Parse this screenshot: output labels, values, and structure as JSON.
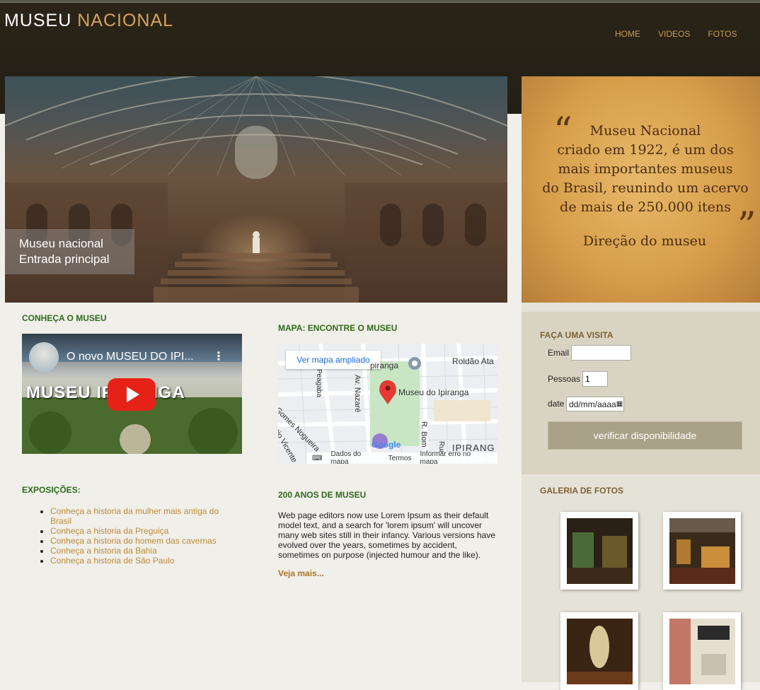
{
  "header": {
    "logo_part1": "MUSEU ",
    "logo_part2": "NACIONAL",
    "nav": [
      "HOME",
      "VIDEOS",
      "FOTOS"
    ]
  },
  "hero": {
    "caption_line1": "Museu nacional",
    "caption_line2": "Entrada principal"
  },
  "quote": {
    "open_mark": "“",
    "close_mark": "”",
    "lines": [
      "Museu Nacional",
      "criado em 1922, é um dos",
      "mais importantes museus",
      "do Brasil, reunindo um acervo",
      "de mais de 250.000 itens"
    ],
    "signature": "Direção do museu"
  },
  "conheca": {
    "title": "CONHEÇA O MUSEU",
    "video_title": "O novo MUSEU DO IPI...",
    "video_overlay": "MUSEU         IPIRANGA"
  },
  "mapa": {
    "title": "MAPA: ENCONTRE O MUSEU",
    "open_button": "Ver mapa ampliado",
    "place_label": "Museu do Ipiranga",
    "streets": [
      "Roldão Ata",
      "Av. Nazaré",
      "Gomes Nogueira",
      "R. Bom",
      "cio Vicente",
      "IPIRANG",
      "Rua",
      "Peagaba",
      "piranga"
    ],
    "google_label": "Google",
    "footer": [
      "Dados do mapa",
      "Termos",
      "Informar erro no mapa"
    ]
  },
  "exposicoes": {
    "title": "EXPOSIÇÕES:",
    "items": [
      "Conheça a historia da mulher mais antiga do Brasil",
      "Conheça a historia da Preguiça",
      "Conheça a historia do homem das cavernas",
      "Conheça a historia da Bahia",
      "Conheça a historia de São Paulo"
    ]
  },
  "anos": {
    "title": "200 ANOS DE MUSEU",
    "text": "Web page editors now use Lorem Ipsum as their default model text, and a search for 'lorem ipsum' will uncover many web sites still in their infancy. Various versions have evolved over the years, sometimes by accident, sometimes on purpose (injected humour and the like).",
    "more": "Veja mais..."
  },
  "visita": {
    "title": "FAÇA UMA VISITA",
    "email_label": "Email",
    "email_value": "",
    "pessoas_label": "Pessoas",
    "pessoas_value": "1",
    "date_label": "date",
    "date_placeholder": "dd/mm/aaaa",
    "button": "verificar disponibilidade"
  },
  "galeria": {
    "title": "GALERIA DE FOTOS",
    "photos": [
      "gallery-photo-1",
      "gallery-photo-2",
      "gallery-photo-3",
      "gallery-photo-4"
    ]
  },
  "colors": {
    "header_bg": "#241f15",
    "accent_gold": "#d7a25a",
    "green_heading": "#2f6a1a",
    "brown_heading": "#7e6234",
    "button_bg": "#a9a088"
  }
}
